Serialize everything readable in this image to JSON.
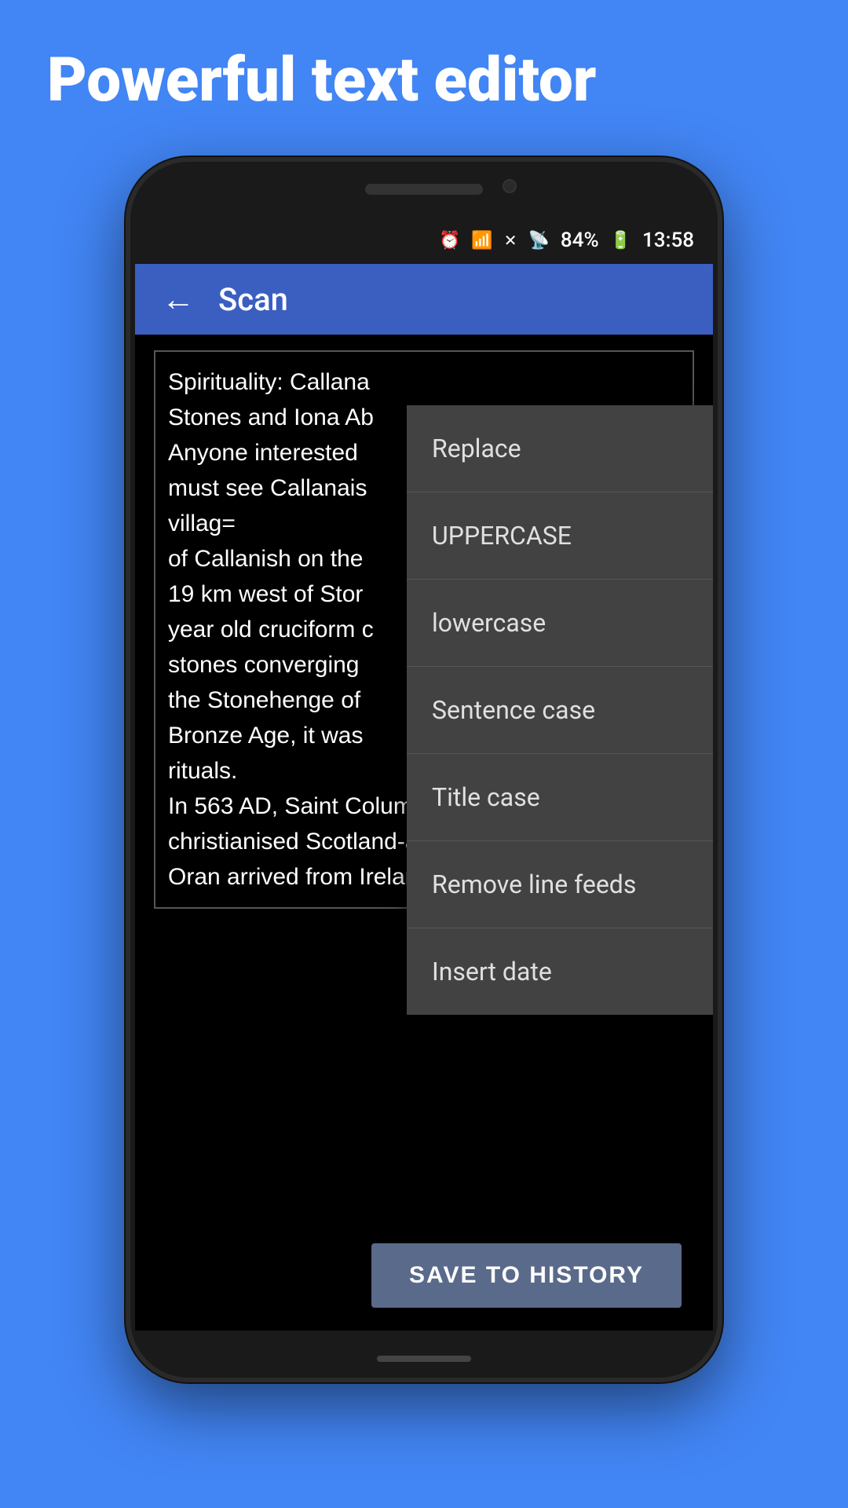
{
  "page": {
    "header_title": "Powerful text editor",
    "background_color": "#4285f4"
  },
  "status_bar": {
    "battery_percent": "84%",
    "time": "13:58",
    "icons": [
      "alarm",
      "wifi",
      "signal-crossed",
      "signal",
      "battery"
    ]
  },
  "toolbar": {
    "title": "Scan",
    "back_label": "←"
  },
  "editor": {
    "content": "Spirituality: Callana Stones and Iona Ab Anyone interested must see Callanais villag=\nof Callanish on the 19 km west of Stor year old cruciform s stones converging the Stonehenge of Bronze Age, it was rituals.\nIn 563 AD, Saint Columba - the man who christianised Scotland-and his companion Saint Oran arrived from Ireland"
  },
  "dropdown": {
    "items": [
      {
        "id": "replace",
        "label": "Replace"
      },
      {
        "id": "uppercase",
        "label": "UPPERCASE"
      },
      {
        "id": "lowercase",
        "label": "lowercase"
      },
      {
        "id": "sentence-case",
        "label": "Sentence case"
      },
      {
        "id": "title-case",
        "label": "Title case"
      },
      {
        "id": "remove-line-feeds",
        "label": "Remove line feeds"
      },
      {
        "id": "insert-date",
        "label": "Insert date"
      }
    ]
  },
  "bottom": {
    "save_button_label": "SAVE TO HISTORY"
  }
}
